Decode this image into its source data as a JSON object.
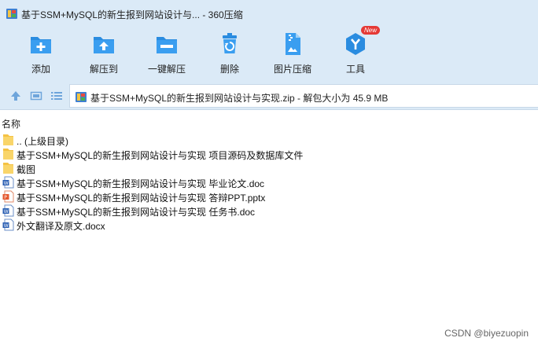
{
  "window": {
    "title": "基于SSM+MySQL的新生报到网站设计与...  - 360压缩"
  },
  "toolbar": {
    "items": [
      {
        "label": "添加",
        "icon": "add-icon"
      },
      {
        "label": "解压到",
        "icon": "extract-to-icon"
      },
      {
        "label": "一键解压",
        "icon": "one-click-extract-icon"
      },
      {
        "label": "删除",
        "icon": "delete-icon"
      },
      {
        "label": "图片压缩",
        "icon": "image-compress-icon"
      },
      {
        "label": "工具",
        "icon": "tools-icon",
        "badge": "New"
      }
    ]
  },
  "address": {
    "path": "基于SSM+MySQL的新生报到网站设计与实现.zip - 解包大小为 45.9 MB"
  },
  "filelist": {
    "column_name": "名称",
    "rows": [
      {
        "name": ".. (上级目录)",
        "type": "folder"
      },
      {
        "name": "基于SSM+MySQL的新生报到网站设计与实现 项目源码及数据库文件",
        "type": "folder"
      },
      {
        "name": "截图",
        "type": "folder"
      },
      {
        "name": "基于SSM+MySQL的新生报到网站设计与实现 毕业论文.doc",
        "type": "doc"
      },
      {
        "name": "基于SSM+MySQL的新生报到网站设计与实现 答辩PPT.pptx",
        "type": "ppt"
      },
      {
        "name": "基于SSM+MySQL的新生报到网站设计与实现 任务书.doc",
        "type": "doc"
      },
      {
        "name": "外文翻译及原文.docx",
        "type": "doc"
      }
    ]
  },
  "watermark": "CSDN @biyezuopin",
  "colors": {
    "chrome_bg": "#dbeaf7",
    "icon_blue": "#2a8ce0",
    "folder_yellow": "#f5c244",
    "ppt_orange": "#e4572e",
    "badge_red": "#e53935"
  }
}
